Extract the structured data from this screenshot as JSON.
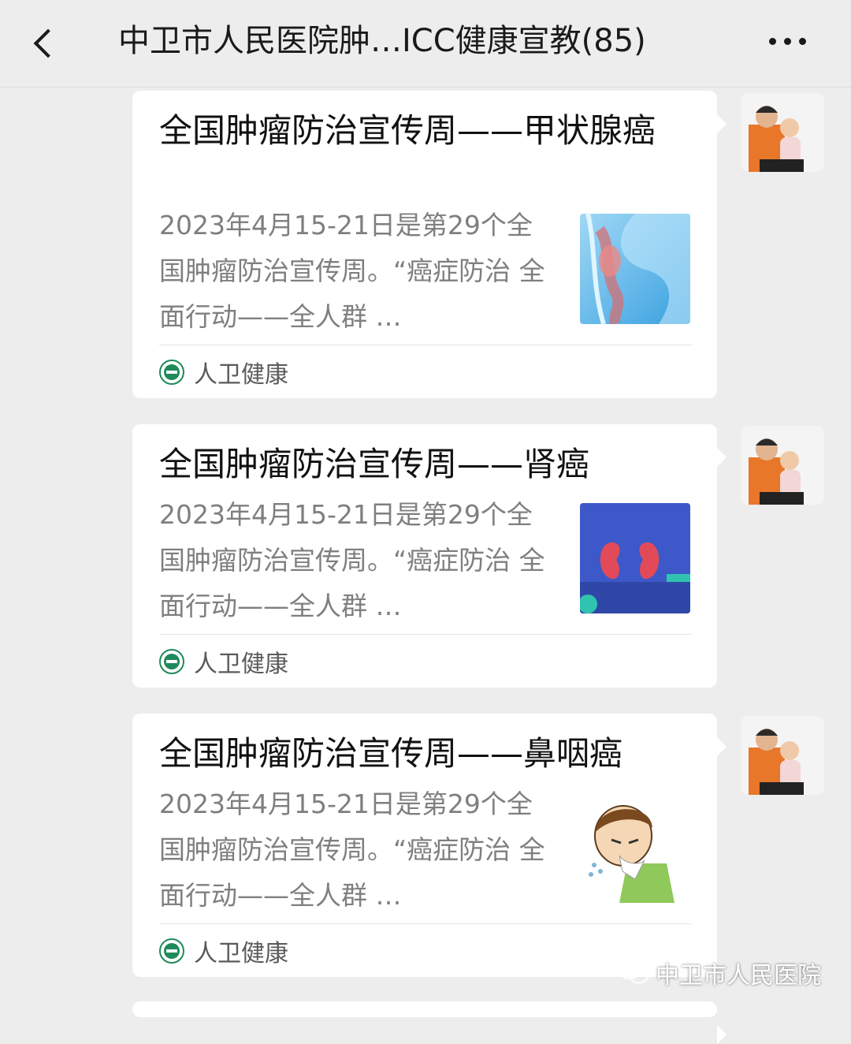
{
  "header": {
    "title": "中卫市人民医院肿…ICC健康宣教(85)"
  },
  "messages": [
    {
      "title": "全国肿瘤防治宣传周——甲状腺癌",
      "desc": "2023年4月15-21日是第29个全国肿瘤防治宣传周。“癌症防治  全面行动——全人群 …",
      "source": "人卫健康",
      "thumb_icon": "thyroid-illustration-icon"
    },
    {
      "title": "全国肿瘤防治宣传周——肾癌",
      "desc": "2023年4月15-21日是第29个全国肿瘤防治宣传周。“癌症防治  全面行动——全人群 …",
      "source": "人卫健康",
      "thumb_icon": "kidney-illustration-icon"
    },
    {
      "title": "全国肿瘤防治宣传周——鼻咽癌",
      "desc": "2023年4月15-21日是第29个全国肿瘤防治宣传周。“癌症防治  全面行动——全人群 …",
      "source": "人卫健康",
      "thumb_icon": "sneezing-boy-illustration-icon"
    }
  ],
  "watermark": {
    "text": "中卫市人民医院"
  },
  "colors": {
    "background": "#ededed",
    "card": "#ffffff",
    "desc_text": "#7f7f7f",
    "source_logo": "#1f8a5a"
  }
}
